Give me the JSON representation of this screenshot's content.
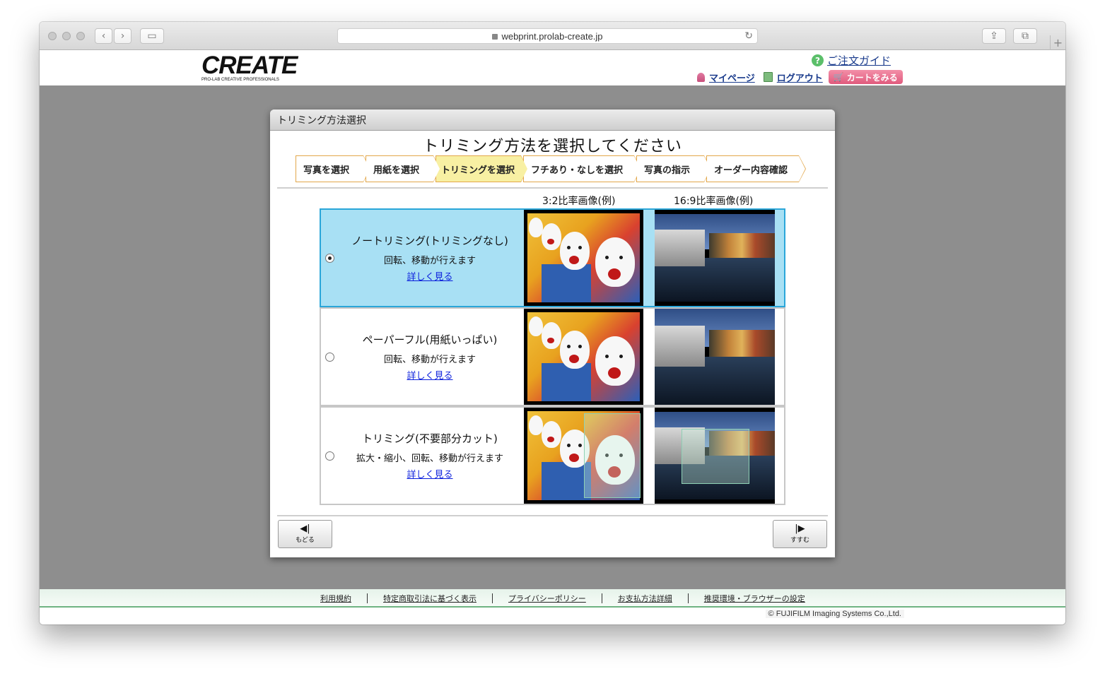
{
  "browser": {
    "url": "webprint.prolab-create.jp",
    "new_tab": "+"
  },
  "header": {
    "logo_text": "CREATE",
    "logo_sub": "PRO-LAB CREATIVE PROFESSIONALS",
    "guide_label": "ご注文ガイド",
    "mypage_label": "マイページ",
    "logout_label": "ログアウト",
    "cart_label": "カートをみる"
  },
  "dialog": {
    "title": "トリミング方法選択",
    "heading": "トリミング方法を選択してください",
    "steps": [
      {
        "label": "写真を選択",
        "active": false
      },
      {
        "label": "用紙を選択",
        "active": false
      },
      {
        "label": "トリミングを選択",
        "active": true
      },
      {
        "label": "フチあり・なしを選択",
        "active": false
      },
      {
        "label": "写真の指示",
        "active": false
      },
      {
        "label": "オーダー内容確認",
        "active": false
      }
    ],
    "col_32": "3:2比率画像(例)",
    "col_169": "16:9比率画像(例)",
    "options": [
      {
        "title": "ノートリミング(トリミングなし)",
        "desc": "回転、移動が行えます",
        "link": "詳しく見る",
        "selected": true
      },
      {
        "title": "ペーパーフル(用紙いっぱい)",
        "desc": "回転、移動が行えます",
        "link": "詳しく見る",
        "selected": false
      },
      {
        "title": "トリミング(不要部分カット)",
        "desc": "拡大・縮小、回転、移動が行えます",
        "link": "詳しく見る",
        "selected": false
      }
    ],
    "back_label": "もどる",
    "next_label": "すすむ"
  },
  "footer": {
    "links": [
      "利用規約",
      "特定商取引法に基づく表示",
      "プライバシーポリシー",
      "お支払方法詳細",
      "推奨環境・ブラウザーの設定"
    ],
    "copyright": "FUJIFILM Imaging Systems Co.,Ltd."
  },
  "colors": {
    "selected_bg": "#a8e0f4",
    "selected_border": "#2aa6d9",
    "active_step": "#f8f0a3",
    "step_border": "#e3a74a",
    "cart": "#e05a7d",
    "link": "#0a1edc"
  }
}
